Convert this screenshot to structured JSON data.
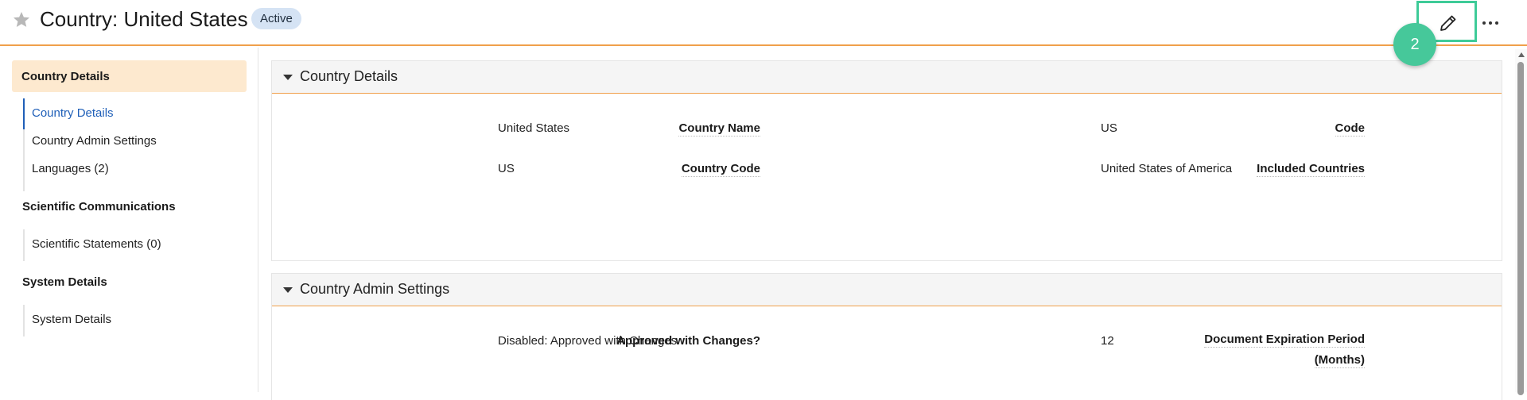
{
  "header": {
    "title": "Country: United States",
    "status": "Active",
    "step_marker": "2",
    "icons": {
      "favorite": "star-icon",
      "edit": "pencil-icon",
      "more": "ellipsis-icon"
    }
  },
  "sidebar": {
    "active_section": "Country Details",
    "items": [
      {
        "label": "Country Details",
        "active": true
      },
      {
        "label": "Country Admin Settings"
      },
      {
        "label": "Languages (2)"
      }
    ],
    "sections": [
      {
        "heading": "Scientific Communications",
        "items": [
          {
            "label": "Scientific Statements (0)"
          }
        ]
      },
      {
        "heading": "System Details",
        "items": [
          {
            "label": "System Details"
          }
        ]
      }
    ]
  },
  "panels": {
    "details": {
      "title": "Country Details",
      "fields": {
        "country_name": {
          "label": "Country Name",
          "value": "United States"
        },
        "code": {
          "label": "Code",
          "value": "US"
        },
        "country_code": {
          "label": "Country Code",
          "value": "US"
        },
        "included_countries": {
          "label": "Included Countries",
          "value": "United States of America"
        }
      }
    },
    "admin": {
      "title": "Country Admin Settings",
      "fields": {
        "approved_with_changes": {
          "label": "Approved with Changes?",
          "value": "Disabled: Approved with Changes"
        },
        "doc_expiration": {
          "label_line1": "Document Expiration Period",
          "label_line2": "(Months)",
          "value": "12"
        }
      }
    }
  },
  "colors": {
    "accent": "#f0a04b",
    "link": "#1f5fb8",
    "highlight": "#3ecb98",
    "badge": "#d5e3f4"
  }
}
